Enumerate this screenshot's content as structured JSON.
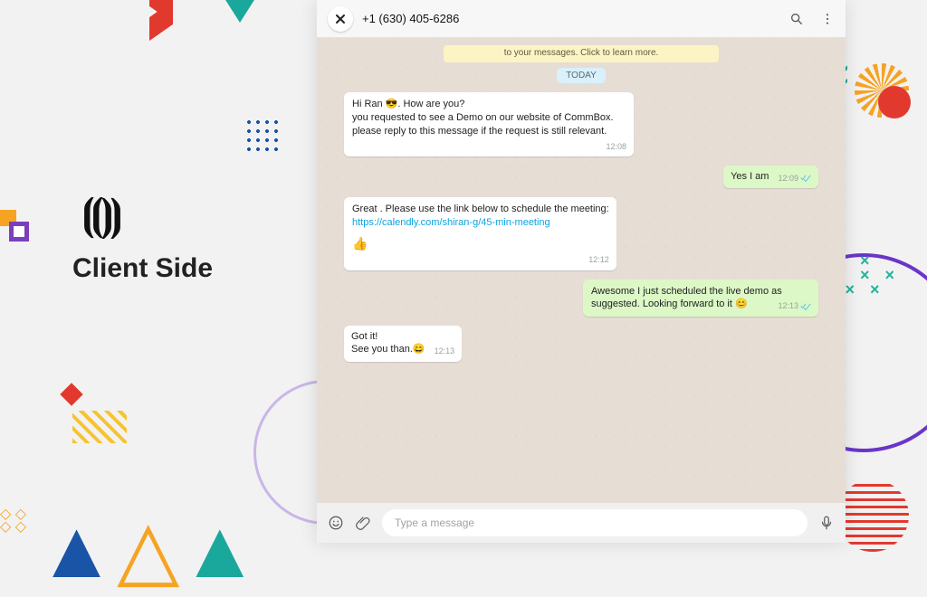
{
  "page": {
    "client_side_label": "Client Side"
  },
  "header": {
    "phone": "+1 (630) 405-6286"
  },
  "banner": {
    "text": "to your messages. Click to learn more."
  },
  "date_chip": "TODAY",
  "messages": [
    {
      "id": "m1",
      "dir": "in",
      "time": "12:08",
      "lines": [
        "Hi Ran 😎. How are you?",
        "you requested to see a Demo on our website of CommBox.",
        "please reply to this message if the request is still relevant."
      ]
    },
    {
      "id": "m2",
      "dir": "out",
      "time": "12:09",
      "read": true,
      "lines": [
        "Yes I am"
      ]
    },
    {
      "id": "m3",
      "dir": "in",
      "time": "12:12",
      "lines": [
        "Great . Please use the link below to schedule the meeting:"
      ],
      "link": "https://calendly.com/shiran-g/45-min-meeting",
      "emoji_trail": "👍"
    },
    {
      "id": "m4",
      "dir": "out",
      "time": "12:13",
      "read": true,
      "lines": [
        "Awesome I just scheduled the live demo as suggested. Looking forward to it 😊"
      ]
    },
    {
      "id": "m5",
      "dir": "in",
      "time": "12:13",
      "lines": [
        "Got it!",
        "See you than.😄"
      ]
    }
  ],
  "composer": {
    "placeholder": "Type a message"
  }
}
